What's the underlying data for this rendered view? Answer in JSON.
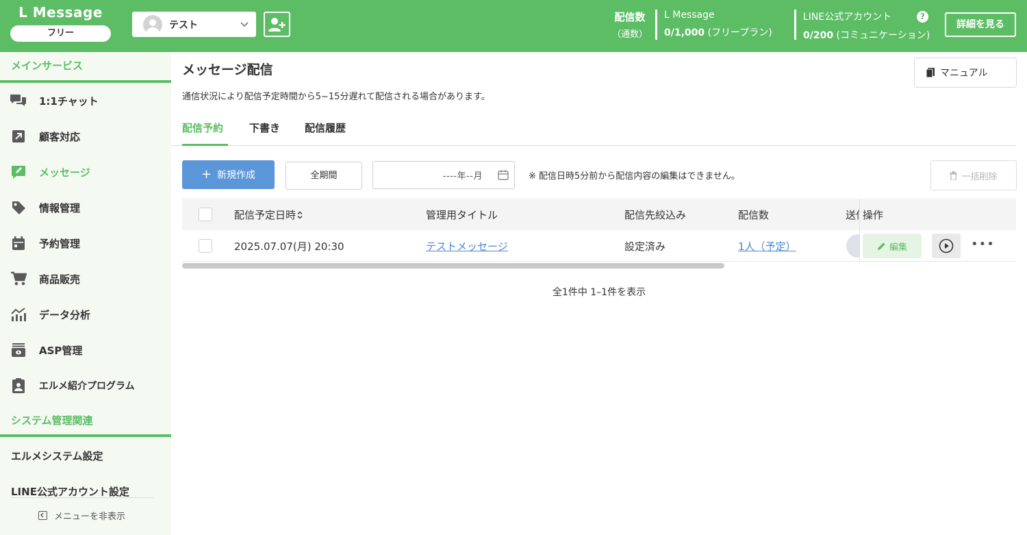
{
  "header": {
    "brand": "L Message",
    "plan": "フリー",
    "account_name": "テスト",
    "stats_label_line1": "配信数",
    "stats_label_line2": "（通数）",
    "lmessage_title": "L Message",
    "lmessage_value": "0/1,000",
    "lmessage_plan": " (フリープラン)",
    "line_title": "LINE公式アカウント",
    "line_value": "0/200",
    "line_plan": " (コミュニケーション)",
    "help": "?",
    "details_button": "詳細を見る"
  },
  "sidebar": {
    "section_main": "メインサービス",
    "items": [
      {
        "label": "1:1チャット",
        "icon": "chat-icon"
      },
      {
        "label": "顧客対応",
        "icon": "arrow-up-right-icon"
      },
      {
        "label": "メッセージ",
        "icon": "message-edit-icon"
      },
      {
        "label": "情報管理",
        "icon": "tag-icon"
      },
      {
        "label": "予約管理",
        "icon": "calendar-icon"
      },
      {
        "label": "商品販売",
        "icon": "cart-icon"
      },
      {
        "label": "データ分析",
        "icon": "chart-icon"
      },
      {
        "label": "ASP管理",
        "icon": "asp-icon"
      },
      {
        "label": "エルメ紹介プログラム",
        "icon": "clipboard-user-icon"
      }
    ],
    "section_system": "システム管理関連",
    "system_items": [
      "エルメシステム設定",
      "LINE公式アカウント設定"
    ],
    "hide_menu": "メニューを非表示"
  },
  "main": {
    "title": "メッセージ配信",
    "manual_button": "マニュアル",
    "notice": "通信状況により配信予定時間から5~15分遅れて配信される場合があります。",
    "tabs": [
      "配信予約",
      "下書き",
      "配信履歴"
    ],
    "new_button": "新規作成",
    "period_button": "全期間",
    "month_input": "----年--月",
    "edit_note": "※ 配信日時5分前から配信内容の編集はできません。",
    "bulk_delete": "一括削除",
    "table": {
      "headers": [
        "配信予定日時",
        "管理用タイトル",
        "配信先絞込み",
        "配信数",
        "送信",
        "操作"
      ],
      "rows": [
        {
          "datetime": "2025.07.07(月) 20:30",
          "title": "テストメッセージ",
          "filter": "設定済み",
          "count": "1人（予定）",
          "edit": "編集"
        }
      ]
    },
    "pager": "全1件中 1–1件を表示"
  },
  "colors": {
    "brand_green": "#5cbd65",
    "primary_blue": "#5b97d8",
    "link_blue": "#4a86d4"
  }
}
